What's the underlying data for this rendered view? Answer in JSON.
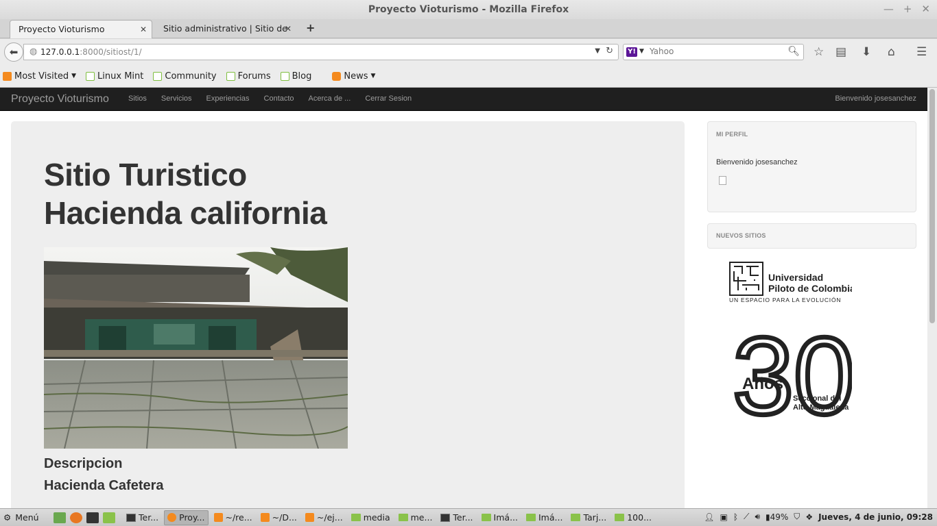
{
  "window": {
    "title": "Proyecto Vioturismo - Mozilla Firefox",
    "controls": [
      "—",
      "+",
      "✕"
    ]
  },
  "tabs": [
    {
      "label": "Proyecto Vioturismo",
      "active": true
    },
    {
      "label": "Sitio administrativo | Sitio de ...",
      "active": false
    }
  ],
  "new_tab_label": "+",
  "urlbar": {
    "host": "127.0.0.1",
    "path": ":8000/sitiost/1/"
  },
  "searchbar": {
    "engine": "Y!",
    "placeholder": "Yahoo"
  },
  "bookmarks": [
    {
      "label": "Most Visited",
      "icon": "folder-icon",
      "dropdown": true
    },
    {
      "label": "Linux Mint",
      "icon": "mint-icon",
      "dropdown": false
    },
    {
      "label": "Community",
      "icon": "mint-icon",
      "dropdown": false
    },
    {
      "label": "Forums",
      "icon": "mint-icon",
      "dropdown": false
    },
    {
      "label": "Blog",
      "icon": "mint-icon",
      "dropdown": false
    },
    {
      "label": "News",
      "icon": "rss-icon",
      "dropdown": true
    }
  ],
  "site": {
    "brand": "Proyecto Vioturismo",
    "nav": [
      "Sitios",
      "Servicios",
      "Experiencias",
      "Contacto",
      "Acerca de ...",
      "Cerrar Sesion"
    ],
    "welcome": "Bienvenido josesanchez"
  },
  "hero": {
    "title_line1": "Sitio Turistico",
    "title_line2": "Hacienda california",
    "description_heading": "Descripcion",
    "description_value": "Hacienda Cafetera"
  },
  "sidebar": {
    "perfil_heading": "MI PERFIL",
    "perfil_text": "Bienvenido josesanchez",
    "nuevos_heading": "NUEVOS SITIOS"
  },
  "logo": {
    "university_line1": "Universidad",
    "university_line2": "Piloto de Colombia",
    "tagline": "UN ESPACIO PARA LA EVOLUCIÓN",
    "number": "30",
    "anos": "Años",
    "seccional_line1": "Seccional del",
    "seccional_line2": "Alto Magdalena"
  },
  "taskbar": {
    "menu_label": "Menú",
    "tasks": [
      {
        "label": "Ter...",
        "icon": "terminal-icon",
        "active": false
      },
      {
        "label": "Proy...",
        "icon": "firefox-icon",
        "active": true
      },
      {
        "label": "~/re...",
        "icon": "editor-icon",
        "active": false
      },
      {
        "label": "~/D...",
        "icon": "editor-icon",
        "active": false
      },
      {
        "label": "~/ej...",
        "icon": "editor-icon",
        "active": false
      },
      {
        "label": "media",
        "icon": "folder-icon",
        "active": false
      },
      {
        "label": "me...",
        "icon": "folder-icon",
        "active": false
      },
      {
        "label": "Ter...",
        "icon": "terminal-icon",
        "active": false
      },
      {
        "label": "Imá...",
        "icon": "folder-icon",
        "active": false
      },
      {
        "label": "Imá...",
        "icon": "folder-icon",
        "active": false
      },
      {
        "label": "Tarj...",
        "icon": "folder-icon",
        "active": false
      },
      {
        "label": "100...",
        "icon": "folder-icon",
        "active": false
      }
    ],
    "battery": "49%",
    "clock": "Jueves,  4 de junio, 09:28"
  }
}
